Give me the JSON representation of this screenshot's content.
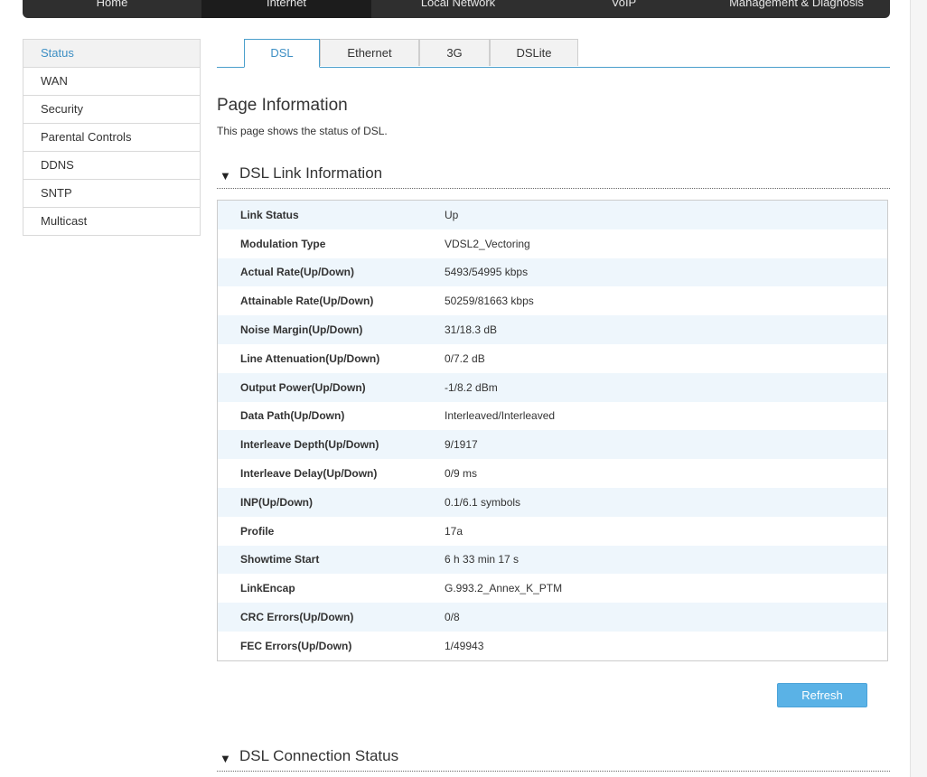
{
  "topnav": {
    "items": [
      "Home",
      "Internet",
      "Local Network",
      "VoIP",
      "Management & Diagnosis"
    ]
  },
  "sidebar": {
    "items": [
      "Status",
      "WAN",
      "Security",
      "Parental Controls",
      "DDNS",
      "SNTP",
      "Multicast"
    ],
    "active": "Status"
  },
  "tabs": {
    "items": [
      "DSL",
      "Ethernet",
      "3G",
      "DSLite"
    ],
    "active": "DSL"
  },
  "page": {
    "title": "Page Information",
    "description": "This page shows the status of DSL."
  },
  "sections": {
    "link_info": "DSL Link Information",
    "connection_status": "DSL Connection Status"
  },
  "link_info": {
    "rows": [
      {
        "label": "Link Status",
        "value": "Up"
      },
      {
        "label": "Modulation Type",
        "value": "VDSL2_Vectoring"
      },
      {
        "label": "Actual Rate(Up/Down)",
        "value": "5493/54995 kbps"
      },
      {
        "label": "Attainable Rate(Up/Down)",
        "value": "50259/81663 kbps"
      },
      {
        "label": "Noise Margin(Up/Down)",
        "value": "31/18.3 dB"
      },
      {
        "label": "Line Attenuation(Up/Down)",
        "value": "0/7.2 dB"
      },
      {
        "label": "Output Power(Up/Down)",
        "value": "-1/8.2 dBm"
      },
      {
        "label": "Data Path(Up/Down)",
        "value": "Interleaved/Interleaved"
      },
      {
        "label": "Interleave Depth(Up/Down)",
        "value": "9/1917"
      },
      {
        "label": "Interleave Delay(Up/Down)",
        "value": "0/9 ms"
      },
      {
        "label": "INP(Up/Down)",
        "value": "0.1/6.1 symbols"
      },
      {
        "label": "Profile",
        "value": "17a"
      },
      {
        "label": "Showtime Start",
        "value": "6 h 33 min 17 s"
      },
      {
        "label": "LinkEncap",
        "value": "G.993.2_Annex_K_PTM"
      },
      {
        "label": "CRC Errors(Up/Down)",
        "value": "0/8"
      },
      {
        "label": "FEC Errors(Up/Down)",
        "value": "1/49943"
      }
    ]
  },
  "buttons": {
    "refresh": "Refresh"
  },
  "icons": {
    "section_toggle": "triangle-down-icon"
  },
  "colors": {
    "accent": "#3d8fc4",
    "button": "#5ab2e6",
    "row_stripe": "#eef6fc",
    "nav_bg": "#2f2f2f"
  }
}
